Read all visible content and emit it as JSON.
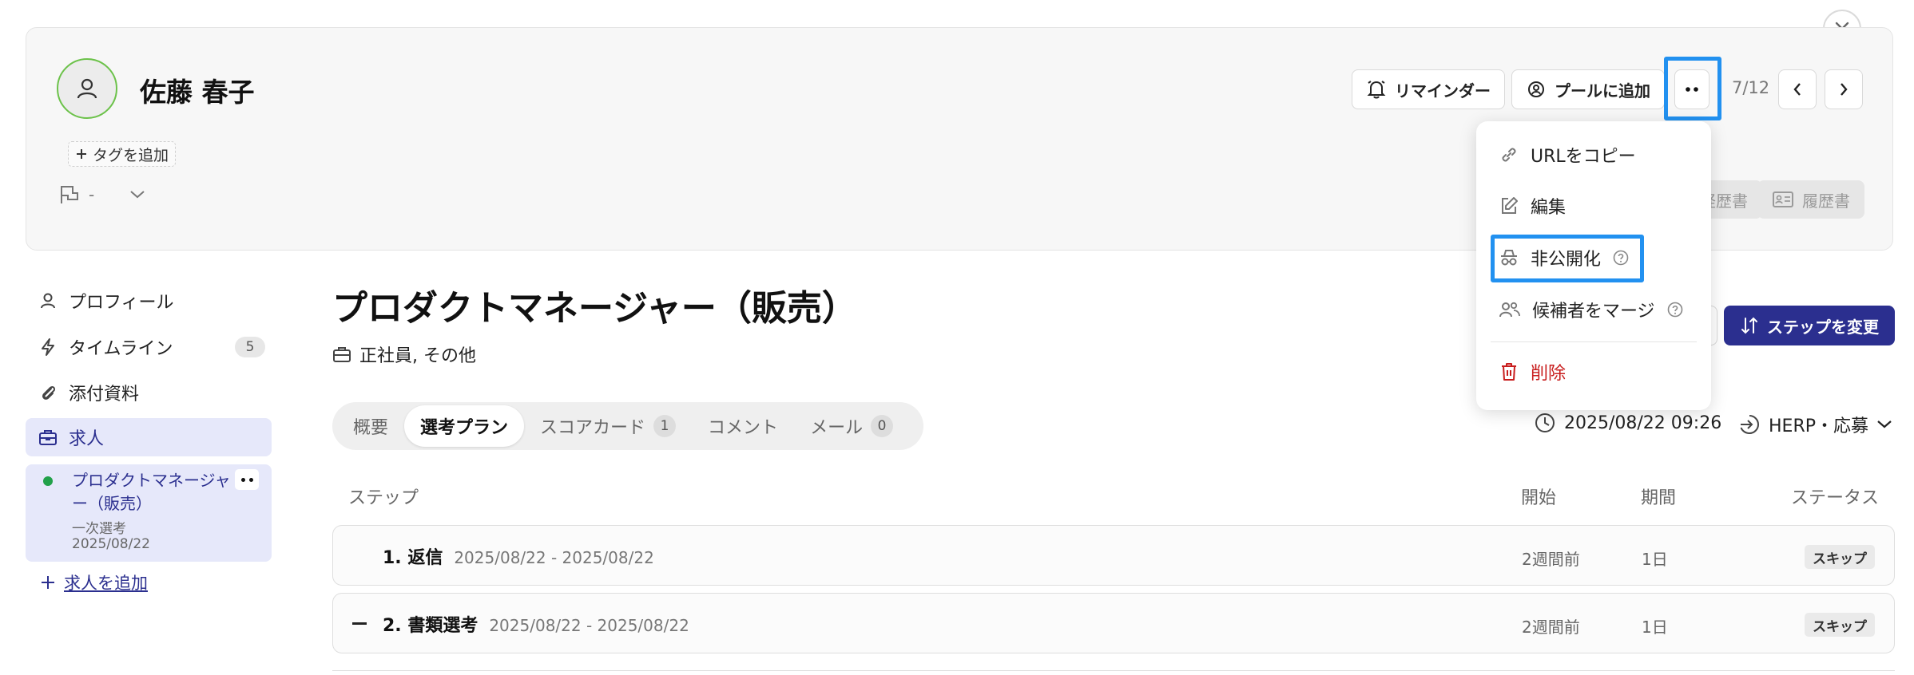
{
  "candidate": {
    "name": "佐藤 春子",
    "tag_add_label": "タグを追加",
    "flag_value": "-"
  },
  "toolbar": {
    "reminder_label": "リマインダー",
    "pool_label": "プールに追加",
    "pager": "7/12",
    "doc_buttons": [
      "経歴書",
      "履歴書"
    ]
  },
  "menu": {
    "items": [
      {
        "label": "URLをコピー",
        "icon": "link-icon"
      },
      {
        "label": "編集",
        "icon": "edit-icon"
      },
      {
        "label": "非公開化",
        "icon": "incognito-icon"
      },
      {
        "label": "候補者をマージ",
        "icon": "users-icon"
      },
      {
        "label": "削除",
        "icon": "trash-icon"
      }
    ],
    "danger_color": "#c81d1d"
  },
  "sidebar": {
    "items": [
      {
        "label": "プロフィール",
        "icon": "user-icon"
      },
      {
        "label": "タイムライン",
        "icon": "bolt-icon",
        "count": "5"
      },
      {
        "label": "添付資料",
        "icon": "paperclip-icon"
      },
      {
        "label": "求人",
        "icon": "briefcase-icon"
      }
    ],
    "job": {
      "title": "プロダクトマネージャー（販売）",
      "step": "一次選考",
      "date": "2025/08/22"
    },
    "add_job_label": "求人を追加"
  },
  "main": {
    "title": "プロダクトマネージャー（販売）",
    "employment_type": "正社員, その他",
    "change_step_label": "ステップを変更",
    "tabs": [
      {
        "label": "概要"
      },
      {
        "label": "選考プラン",
        "active": true
      },
      {
        "label": "スコアカード",
        "count": "1"
      },
      {
        "label": "コメント"
      },
      {
        "label": "メール",
        "count": "0"
      }
    ],
    "applied_at": "2025/08/22 09:26",
    "source": "HERP・応募",
    "table": {
      "headers": [
        "ステップ",
        "開始",
        "期間",
        "ステータス"
      ],
      "rows": [
        {
          "name": "1. 返信",
          "range": "2025/08/22 - 2025/08/22",
          "start": "2週間前",
          "duration": "1日",
          "status": "スキップ"
        },
        {
          "name": "2. 書類選考",
          "range": "2025/08/22 - 2025/08/22",
          "start": "2週間前",
          "duration": "1日",
          "status": "スキップ"
        }
      ]
    }
  },
  "colors": {
    "accent": "#2b2f8f",
    "highlight": "#2291f0",
    "avatar_ring": "#6cc24a",
    "job_dot": "#22a14a"
  }
}
